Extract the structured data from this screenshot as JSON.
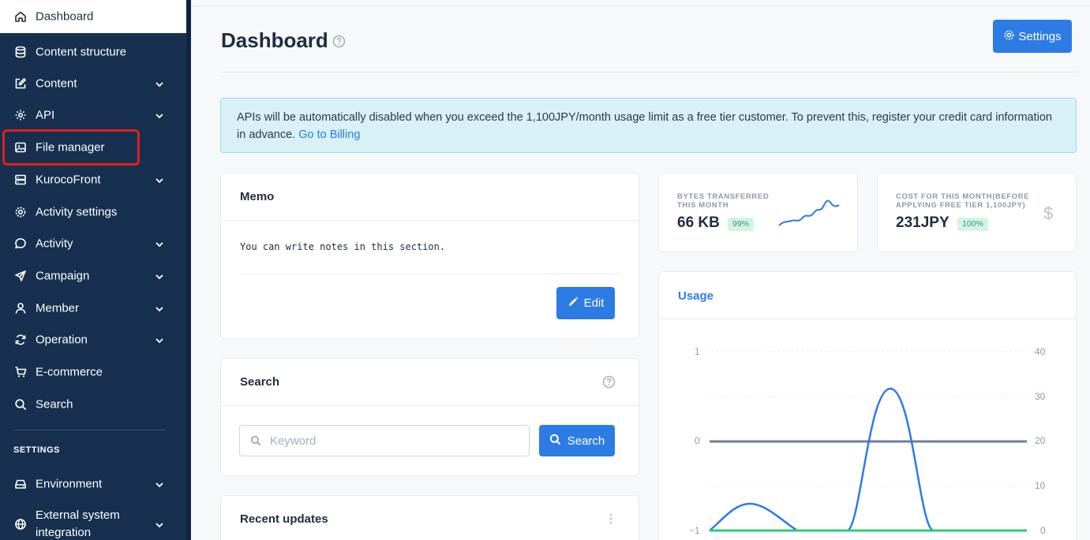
{
  "sidebar": {
    "items": [
      {
        "label": "Dashboard",
        "icon": "home-icon"
      },
      {
        "label": "Content structure",
        "icon": "database-icon"
      },
      {
        "label": "Content",
        "icon": "edit-icon"
      },
      {
        "label": "API",
        "icon": "code-icon"
      },
      {
        "label": "File manager",
        "icon": "image-icon"
      },
      {
        "label": "KurocoFront",
        "icon": "server-icon"
      },
      {
        "label": "Activity settings",
        "icon": "gear-icon"
      },
      {
        "label": "Activity",
        "icon": "chat-icon"
      },
      {
        "label": "Campaign",
        "icon": "send-icon"
      },
      {
        "label": "Member",
        "icon": "user-icon"
      },
      {
        "label": "Operation",
        "icon": "sync-icon"
      },
      {
        "label": "E-commerce",
        "icon": "cart-icon"
      },
      {
        "label": "Search",
        "icon": "search-icon"
      }
    ],
    "settings_heading": "SETTINGS",
    "settings_items": [
      {
        "label": "Environment",
        "icon": "drive-icon"
      },
      {
        "label": "External system integration",
        "icon": "globe-icon"
      }
    ]
  },
  "header": {
    "title": "Dashboard",
    "settings_label": "Settings"
  },
  "alert": {
    "text": "APIs will be automatically disabled when you exceed the 1,100JPY/month usage limit as a free tier customer. To prevent this, register your credit card information in advance. ",
    "link": "Go to Billing"
  },
  "memo": {
    "title": "Memo",
    "text": "You can write notes in this section.",
    "edit_label": "Edit"
  },
  "search": {
    "title": "Search",
    "placeholder": "Keyword",
    "button_label": "Search"
  },
  "recent": {
    "title": "Recent updates"
  },
  "stats": {
    "bytes": {
      "label": "BYTES TRANSFERRED THIS MONTH",
      "value": "66 KB",
      "badge": "99%"
    },
    "cost": {
      "label": "COST FOR THIS MONTH(BEFORE APPLYING FREE TIER 1,100JPY)",
      "value": "231JPY",
      "badge": "100%"
    }
  },
  "usage": {
    "title": "Usage",
    "left_ticks": [
      "1",
      "0",
      "−1"
    ],
    "right_ticks": [
      "40",
      "30",
      "20",
      "10",
      "0"
    ]
  },
  "colors": {
    "sidebar_bg": "#17304f",
    "accent": "#2d7be5",
    "highlight": "#e0201b",
    "series_blue": "#2d7be5",
    "series_green": "#2ecc71",
    "series_gray": "#6d7f99"
  }
}
